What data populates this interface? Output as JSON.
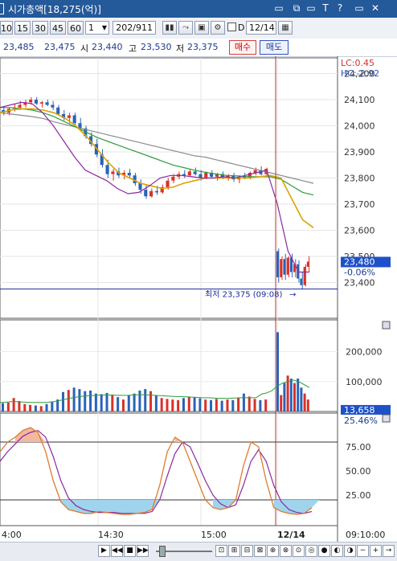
{
  "window": {
    "title": "시가총액[18,275(억)]",
    "buttons": [
      "▭",
      "⧉",
      "▭",
      "T",
      "?",
      "▭",
      "✕"
    ]
  },
  "toolbar": {
    "periods": [
      "10",
      "15",
      "30",
      "45",
      "60"
    ],
    "interval_value": "1",
    "count_text": "202",
    "count_total": "/911",
    "d_label": "D",
    "date_value": "12/14"
  },
  "quote": {
    "v1": "23,485",
    "v2": "23,475",
    "open_label": "시",
    "open": "23,440",
    "high_label": "고",
    "high": "23,530",
    "low_label": "저",
    "low": "23,375",
    "buy_label": "매수",
    "sell_label": "매도"
  },
  "chart": {
    "lc_label": "LC:0.45",
    "hc_label": "HC:-2.92",
    "price_ticks": [
      "24,200",
      "24,100",
      "24,000",
      "23,900",
      "23,800",
      "23,700",
      "23,600",
      "23,500",
      "23,400"
    ],
    "price_min": 23300,
    "price_max": 24260,
    "current_price": "23,480",
    "current_change": "-0.06%",
    "low_annotation": "최저 23,375 (09:08)",
    "volume_ticks": [
      "200,000",
      "100,000"
    ],
    "volume_current": "13,658",
    "volume_pct": "25.46%",
    "osc_ticks": [
      "75.00",
      "50.00",
      "25.00"
    ],
    "time_labels": [
      "4:00",
      "14:30",
      "15:00",
      "12/14",
      "09:10:00"
    ],
    "colors": {
      "up": "#d8322a",
      "down": "#2a63b8",
      "ma_gold": "#d9a400",
      "ma_gray": "#8a8a8a",
      "ma_green": "#2e9c3a",
      "ma_purple": "#8a2aa0",
      "stoch_orange": "#e07a2e",
      "divider": "#c03030",
      "low_line": "#1a2a9a"
    },
    "candles": [
      {
        "o": 24060,
        "h": 24075,
        "l": 24040,
        "c": 24050
      },
      {
        "o": 24050,
        "h": 24070,
        "l": 24040,
        "c": 24065
      },
      {
        "o": 24065,
        "h": 24085,
        "l": 24055,
        "c": 24070
      },
      {
        "o": 24070,
        "h": 24095,
        "l": 24060,
        "c": 24080
      },
      {
        "o": 24080,
        "h": 24100,
        "l": 24070,
        "c": 24090
      },
      {
        "o": 24090,
        "h": 24110,
        "l": 24080,
        "c": 24100
      },
      {
        "o": 24100,
        "h": 24110,
        "l": 24080,
        "c": 24085
      },
      {
        "o": 24085,
        "h": 24095,
        "l": 24070,
        "c": 24090
      },
      {
        "o": 24090,
        "h": 24100,
        "l": 24075,
        "c": 24080
      },
      {
        "o": 24080,
        "h": 24095,
        "l": 24060,
        "c": 24070
      },
      {
        "o": 24070,
        "h": 24080,
        "l": 24040,
        "c": 24045
      },
      {
        "o": 24045,
        "h": 24060,
        "l": 24020,
        "c": 24030
      },
      {
        "o": 24030,
        "h": 24050,
        "l": 24010,
        "c": 24040
      },
      {
        "o": 24040,
        "h": 24050,
        "l": 24000,
        "c": 24010
      },
      {
        "o": 24010,
        "h": 24030,
        "l": 23980,
        "c": 23990
      },
      {
        "o": 23990,
        "h": 24000,
        "l": 23950,
        "c": 23960
      },
      {
        "o": 23960,
        "h": 23975,
        "l": 23920,
        "c": 23930
      },
      {
        "o": 23930,
        "h": 23950,
        "l": 23880,
        "c": 23890
      },
      {
        "o": 23890,
        "h": 23910,
        "l": 23840,
        "c": 23850
      },
      {
        "o": 23850,
        "h": 23870,
        "l": 23800,
        "c": 23815
      },
      {
        "o": 23815,
        "h": 23835,
        "l": 23790,
        "c": 23825
      },
      {
        "o": 23825,
        "h": 23840,
        "l": 23800,
        "c": 23810
      },
      {
        "o": 23810,
        "h": 23830,
        "l": 23795,
        "c": 23820
      },
      {
        "o": 23820,
        "h": 23835,
        "l": 23800,
        "c": 23810
      },
      {
        "o": 23810,
        "h": 23820,
        "l": 23770,
        "c": 23780
      },
      {
        "o": 23780,
        "h": 23795,
        "l": 23740,
        "c": 23755
      },
      {
        "o": 23755,
        "h": 23775,
        "l": 23720,
        "c": 23730
      },
      {
        "o": 23730,
        "h": 23760,
        "l": 23725,
        "c": 23750
      },
      {
        "o": 23750,
        "h": 23770,
        "l": 23735,
        "c": 23745
      },
      {
        "o": 23745,
        "h": 23775,
        "l": 23740,
        "c": 23765
      },
      {
        "o": 23765,
        "h": 23800,
        "l": 23755,
        "c": 23790
      },
      {
        "o": 23790,
        "h": 23815,
        "l": 23780,
        "c": 23805
      },
      {
        "o": 23805,
        "h": 23825,
        "l": 23795,
        "c": 23815
      },
      {
        "o": 23815,
        "h": 23830,
        "l": 23800,
        "c": 23810
      },
      {
        "o": 23810,
        "h": 23835,
        "l": 23805,
        "c": 23825
      },
      {
        "o": 23825,
        "h": 23840,
        "l": 23810,
        "c": 23815
      },
      {
        "o": 23815,
        "h": 23830,
        "l": 23790,
        "c": 23800
      },
      {
        "o": 23800,
        "h": 23825,
        "l": 23795,
        "c": 23820
      },
      {
        "o": 23820,
        "h": 23830,
        "l": 23800,
        "c": 23805
      },
      {
        "o": 23805,
        "h": 23820,
        "l": 23790,
        "c": 23815
      },
      {
        "o": 23815,
        "h": 23825,
        "l": 23795,
        "c": 23800
      },
      {
        "o": 23800,
        "h": 23815,
        "l": 23790,
        "c": 23810
      },
      {
        "o": 23810,
        "h": 23820,
        "l": 23785,
        "c": 23795
      },
      {
        "o": 23795,
        "h": 23810,
        "l": 23780,
        "c": 23805
      },
      {
        "o": 23805,
        "h": 23820,
        "l": 23795,
        "c": 23800
      },
      {
        "o": 23800,
        "h": 23825,
        "l": 23795,
        "c": 23820
      },
      {
        "o": 23820,
        "h": 23840,
        "l": 23810,
        "c": 23830
      },
      {
        "o": 23830,
        "h": 23845,
        "l": 23810,
        "c": 23815
      },
      {
        "o": 23815,
        "h": 23840,
        "l": 23810,
        "c": 23835
      },
      {
        "o": 23520,
        "h": 23530,
        "l": 23400,
        "c": 23420
      },
      {
        "o": 23420,
        "h": 23500,
        "l": 23410,
        "c": 23490
      },
      {
        "o": 23490,
        "h": 23510,
        "l": 23410,
        "c": 23430
      },
      {
        "o": 23430,
        "h": 23500,
        "l": 23420,
        "c": 23495
      },
      {
        "o": 23495,
        "h": 23510,
        "l": 23420,
        "c": 23440
      },
      {
        "o": 23440,
        "h": 23490,
        "l": 23420,
        "c": 23470
      },
      {
        "o": 23470,
        "h": 23485,
        "l": 23400,
        "c": 23415
      },
      {
        "o": 23415,
        "h": 23440,
        "l": 23375,
        "c": 23390
      },
      {
        "o": 23390,
        "h": 23470,
        "l": 23385,
        "c": 23460
      },
      {
        "o": 23460,
        "h": 23500,
        "l": 23440,
        "c": 23480
      }
    ],
    "ma_gold": [
      24050,
      24060,
      24065,
      24065,
      24060,
      24050,
      24030,
      24000,
      23960,
      23910,
      23860,
      23820,
      23800,
      23780,
      23770,
      23760,
      23765,
      23780,
      23790,
      23800,
      23800,
      23800,
      23800,
      23800,
      23805,
      23810,
      23800,
      23720,
      23640,
      23610
    ],
    "ma_gray": [
      24050,
      24045,
      24040,
      24035,
      24028,
      24015,
      24005,
      23995,
      23985,
      23975,
      23965,
      23955,
      23945,
      23935,
      23925,
      23915,
      23905,
      23895,
      23885,
      23880,
      23870,
      23860,
      23850,
      23840,
      23830,
      23820,
      23810,
      23800,
      23790,
      23780
    ],
    "ma_green": [
      24070,
      24070,
      24065,
      24060,
      24050,
      24035,
      24015,
      23995,
      23975,
      23955,
      23940,
      23925,
      23910,
      23895,
      23880,
      23865,
      23850,
      23840,
      23830,
      23822,
      23815,
      23810,
      23808,
      23805,
      23805,
      23805,
      23795,
      23770,
      23745,
      23735
    ],
    "ma_purple": [
      24070,
      24080,
      24090,
      24085,
      24050,
      24000,
      23940,
      23880,
      23830,
      23810,
      23790,
      23760,
      23740,
      23745,
      23770,
      23800,
      23810,
      23810,
      23805,
      23800,
      23800,
      23805,
      23800,
      23810,
      23820,
      23830,
      23700,
      23520,
      23440,
      23440
    ],
    "volumes": [
      28000,
      30000,
      45000,
      35000,
      25000,
      22000,
      20000,
      18000,
      25000,
      32000,
      40000,
      65000,
      72000,
      80000,
      75000,
      68000,
      70000,
      60000,
      58000,
      62000,
      55000,
      48000,
      40000,
      55000,
      60000,
      70000,
      75000,
      68000,
      55000,
      45000,
      42000,
      40000,
      38000,
      45000,
      50000,
      48000,
      44000,
      40000,
      38000,
      42000,
      36000,
      40000,
      38000,
      45000,
      60000,
      50000,
      42000,
      38000,
      40000,
      265000,
      55000,
      95000,
      120000,
      110000,
      95000,
      110000,
      80000,
      60000,
      40000
    ],
    "vol_ma": [
      30000,
      31000,
      33000,
      33000,
      32000,
      31000,
      30000,
      30000,
      30000,
      31000,
      33000,
      36000,
      40000,
      44000,
      47000,
      50000,
      52000,
      53000,
      54000,
      55000,
      55000,
      55000,
      54000,
      54000,
      54000,
      55000,
      56000,
      56000,
      55000,
      54000,
      53000,
      52000,
      51000,
      50000,
      50000,
      49000,
      48000,
      47000,
      46000,
      46000,
      45000,
      44000,
      44000,
      44000,
      45000,
      46000,
      46000,
      46000,
      46000,
      58000,
      62000,
      70000,
      85000,
      95000,
      100000,
      105000,
      100000,
      90000,
      80000
    ],
    "stoch_k": [
      70,
      80,
      85,
      92,
      95,
      90,
      70,
      40,
      18,
      10,
      8,
      6,
      6,
      8,
      7,
      6,
      5,
      5,
      6,
      7,
      10,
      35,
      70,
      85,
      80,
      60,
      40,
      20,
      12,
      10,
      12,
      20,
      55,
      80,
      75,
      40,
      12,
      8,
      6,
      5,
      6,
      12
    ],
    "stoch_d": [
      60,
      70,
      78,
      86,
      90,
      92,
      85,
      65,
      40,
      22,
      14,
      10,
      8,
      7,
      7,
      7,
      6,
      6,
      6,
      6,
      8,
      20,
      45,
      68,
      80,
      75,
      58,
      40,
      25,
      16,
      12,
      15,
      35,
      60,
      72,
      60,
      35,
      18,
      10,
      7,
      6,
      8
    ]
  },
  "bottombar": {
    "zoom_minus": "−",
    "zoom_plus": "+",
    "arrow_label": "→"
  }
}
